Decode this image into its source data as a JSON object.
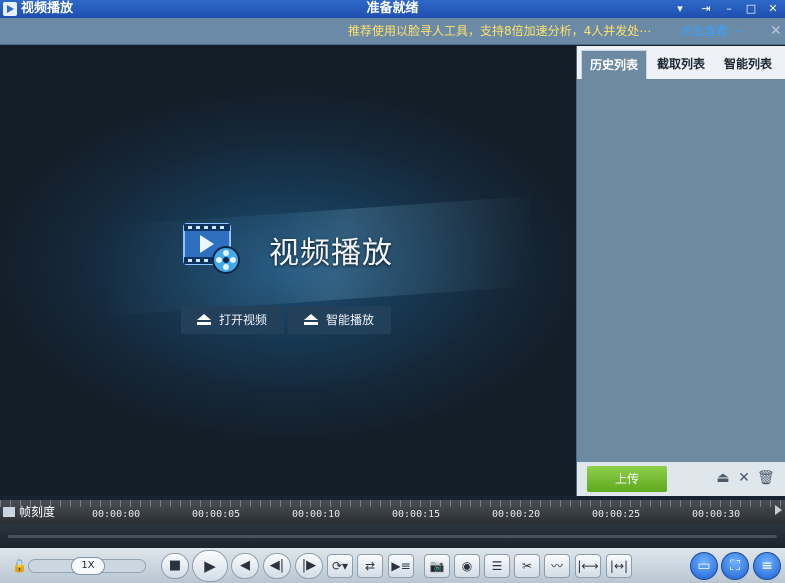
{
  "titlebar": {
    "app_title": "视频播放",
    "status": "准备就绪",
    "buttons": [
      "▾",
      "⇥",
      "–",
      "□",
      "✕"
    ]
  },
  "ticker": {
    "message": "推荐使用以脸寻人工具，支持8倍加速分析，4人并发处⋯",
    "link": "点击查看 ⋯",
    "close": "✕"
  },
  "player": {
    "brand_title": "视频播放",
    "open_video": "打开视频",
    "smart_play": "智能播放"
  },
  "panel": {
    "tabs": [
      "历史列表",
      "截取列表",
      "智能列表"
    ],
    "active_tab": 0,
    "upload": "上传",
    "footer_icons": [
      "eject-icon",
      "close-icon",
      "trash-icon"
    ]
  },
  "timeline": {
    "label": "帧刻度",
    "ticks": [
      "00:00:00",
      "00:00:05",
      "00:00:10",
      "00:00:15",
      "00:00:20",
      "00:00:25",
      "00:00:30"
    ]
  },
  "controls": {
    "speed": "1X",
    "accent": "#1d5fd0"
  }
}
